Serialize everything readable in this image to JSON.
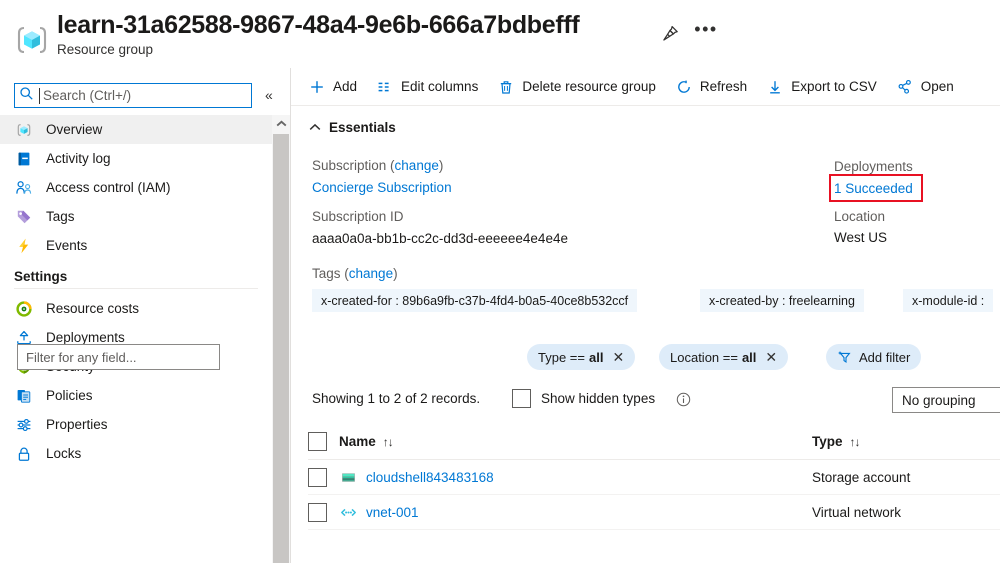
{
  "header": {
    "title": "learn-31a62588-9867-48a4-9e6b-666a7bdbefff",
    "subtitle": "Resource group",
    "rg_icon": "resource-group-cube-icon",
    "pin_icon": "pin-icon",
    "more_label": "•••"
  },
  "sidebar": {
    "search": {
      "placeholder": "Search (Ctrl+/)",
      "icon": "search-icon"
    },
    "collapse_icon": "«",
    "items": [
      {
        "label": "Overview",
        "icon": "resource-group-cube-icon",
        "active": true
      },
      {
        "label": "Activity log",
        "icon": "activity-log-icon",
        "active": false
      },
      {
        "label": "Access control (IAM)",
        "icon": "access-control-people-icon",
        "active": false
      },
      {
        "label": "Tags",
        "icon": "tag-icon",
        "active": false
      },
      {
        "label": "Events",
        "icon": "lightning-bolt-icon",
        "active": false
      }
    ],
    "settings_group": "Settings",
    "settings_items": [
      {
        "label": "Resource costs",
        "icon": "resource-costs-icon"
      },
      {
        "label": "Deployments",
        "icon": "deployments-upload-icon"
      },
      {
        "label": "Security",
        "icon": "shield-icon"
      },
      {
        "label": "Policies",
        "icon": "policies-document-icon"
      },
      {
        "label": "Properties",
        "icon": "properties-sliders-icon"
      },
      {
        "label": "Locks",
        "icon": "lock-icon"
      }
    ],
    "scroll_up_icon": "chevron-up-icon"
  },
  "toolbar": {
    "items": [
      {
        "label": "Add",
        "icon": "plus-icon"
      },
      {
        "label": "Edit columns",
        "icon": "edit-columns-icon"
      },
      {
        "label": "Delete resource group",
        "icon": "trash-icon"
      },
      {
        "label": "Refresh",
        "icon": "refresh-icon"
      },
      {
        "label": "Export to CSV",
        "icon": "download-arrow-icon"
      },
      {
        "label": "Open",
        "icon": "open-query-icon"
      }
    ]
  },
  "essentials": {
    "section_title": "Essentials",
    "collapse_icon": "chevron-up-icon",
    "subscription_label": "Subscription",
    "subscription_change": "change",
    "subscription_value": "Concierge Subscription",
    "subscription_id_label": "Subscription ID",
    "subscription_id_value": "aaaa0a0a-bb1b-cc2c-dd3d-eeeeee4e4e4e",
    "deployments_label": "Deployments",
    "deployments_value": "1 Succeeded",
    "deployments_highlight_color": "#e81123",
    "location_label": "Location",
    "location_value": "West US",
    "tags_label": "Tags",
    "tags_change": "change",
    "tags": [
      "x-created-for : 89b6a9fb-c37b-4fd4-b0a5-40ce8b532ccf",
      "x-created-by : freelearning",
      "x-module-id :"
    ]
  },
  "filters": {
    "field_placeholder": "Filter for any field...",
    "pills": [
      {
        "prefix": "Type ==",
        "value": "all",
        "close_icon": "close-icon"
      },
      {
        "prefix": "Location ==",
        "value": "all",
        "close_icon": "close-icon"
      }
    ],
    "add_filter_label": "Add filter",
    "add_filter_icon": "add-filter-funnel-icon",
    "records_text": "Showing 1 to 2 of 2 records.",
    "show_hidden_label": "Show hidden types",
    "info_icon": "info-icon",
    "grouping_value": "No grouping"
  },
  "table": {
    "columns": [
      {
        "label": "Name",
        "sort_icon": "↑↓"
      },
      {
        "label": "Type",
        "sort_icon": "↑↓"
      }
    ],
    "rows": [
      {
        "name": "cloudshell843483168",
        "type": "Storage account",
        "icon": "storage-account-icon"
      },
      {
        "name": "vnet-001",
        "type": "Virtual network",
        "icon": "virtual-network-icon"
      }
    ]
  },
  "colors": {
    "accent": "#0078d4",
    "link": "#0078d4",
    "highlight_red": "#e81123",
    "pill_bg": "#deecf9",
    "tag_bg": "#eff6fc"
  }
}
